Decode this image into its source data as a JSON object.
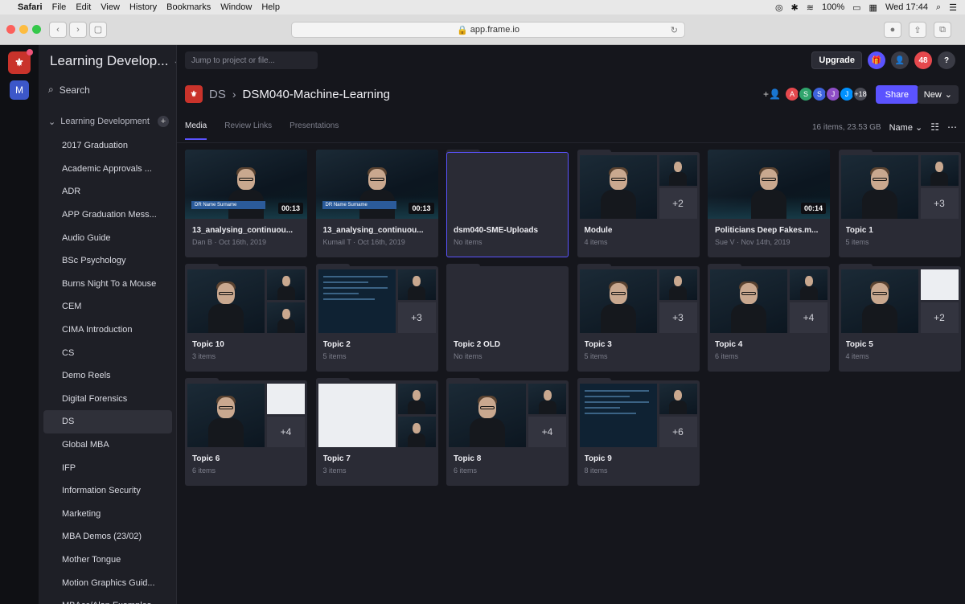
{
  "menubar": {
    "app": "Safari",
    "items": [
      "File",
      "Edit",
      "View",
      "History",
      "Bookmarks",
      "Window",
      "Help"
    ],
    "battery": "100%",
    "clock": "Wed 17:44"
  },
  "browser": {
    "url": "app.frame.io"
  },
  "sidebar": {
    "team": "Learning Develop...",
    "search": "Search",
    "root": "Learning Development",
    "projects": [
      "2017 Graduation",
      "Academic Approvals ...",
      "ADR",
      "APP Graduation Mess...",
      "Audio Guide",
      "BSc Psychology",
      "Burns Night To a Mouse",
      "CEM",
      "CIMA Introduction",
      "CS",
      "Demo Reels",
      "Digital Forensics",
      "DS",
      "Global MBA",
      "IFP",
      "Information Security",
      "Marketing",
      "MBA Demos (23/02)",
      "Mother Tongue",
      "Motion Graphics Guid...",
      "MBAcc/Alan Examples"
    ],
    "active_index": 12
  },
  "topbar": {
    "search_placeholder": "Jump to project or file...",
    "upgrade": "Upgrade",
    "notifications": "48",
    "help": "?"
  },
  "header": {
    "crumb": "DS",
    "title": "DSM040-Machine-Learning",
    "avatars": [
      "A",
      "S",
      "S",
      "J",
      "J"
    ],
    "more_count": "+18",
    "share": "Share",
    "new": "New"
  },
  "tabs": [
    "Media",
    "Review Links",
    "Presentations"
  ],
  "summary": "16 items, 23.53 GB",
  "sort": "Name",
  "colors": {
    "accent": "#5b53ff",
    "brand": "#c9332b"
  },
  "assets": [
    {
      "kind": "video",
      "name": "13_analysing_continuou...",
      "meta": "Dan B · Oct 16th, 2019",
      "duration": "00:13",
      "lower_third": "DR Name Surname"
    },
    {
      "kind": "video",
      "name": "13_analysing_continuou...",
      "meta": "Kumail T · Oct 16th, 2019",
      "duration": "00:13",
      "lower_third": "DR Name Surname"
    },
    {
      "kind": "folder-empty",
      "name": "dsm040-SME-Uploads",
      "meta": "No items"
    },
    {
      "kind": "folder",
      "name": "Module",
      "meta": "4 items",
      "more": "+2"
    },
    {
      "kind": "video",
      "name": "Politicians Deep Fakes.m...",
      "meta": "Sue V · Nov 14th, 2019",
      "duration": "00:14"
    },
    {
      "kind": "folder",
      "name": "Topic 1",
      "meta": "5 items",
      "more": "+3"
    },
    {
      "kind": "folder",
      "name": "Topic 10",
      "meta": "3 items",
      "more": ""
    },
    {
      "kind": "folder",
      "name": "Topic 2",
      "meta": "5 items",
      "more": "+3",
      "slide": true
    },
    {
      "kind": "folder-empty",
      "name": "Topic 2 OLD",
      "meta": "No items"
    },
    {
      "kind": "folder",
      "name": "Topic 3",
      "meta": "5 items",
      "more": "+3"
    },
    {
      "kind": "folder",
      "name": "Topic 4",
      "meta": "6 items",
      "more": "+4"
    },
    {
      "kind": "folder",
      "name": "Topic 5",
      "meta": "4 items",
      "more": "+2",
      "white": true
    },
    {
      "kind": "folder",
      "name": "Topic 6",
      "meta": "6 items",
      "more": "+4",
      "white": true
    },
    {
      "kind": "folder",
      "name": "Topic 7",
      "meta": "3 items",
      "more": "",
      "bigwhite": true
    },
    {
      "kind": "folder",
      "name": "Topic 8",
      "meta": "6 items",
      "more": "+4"
    },
    {
      "kind": "folder",
      "name": "Topic 9",
      "meta": "8 items",
      "more": "+6",
      "slide": true
    }
  ]
}
